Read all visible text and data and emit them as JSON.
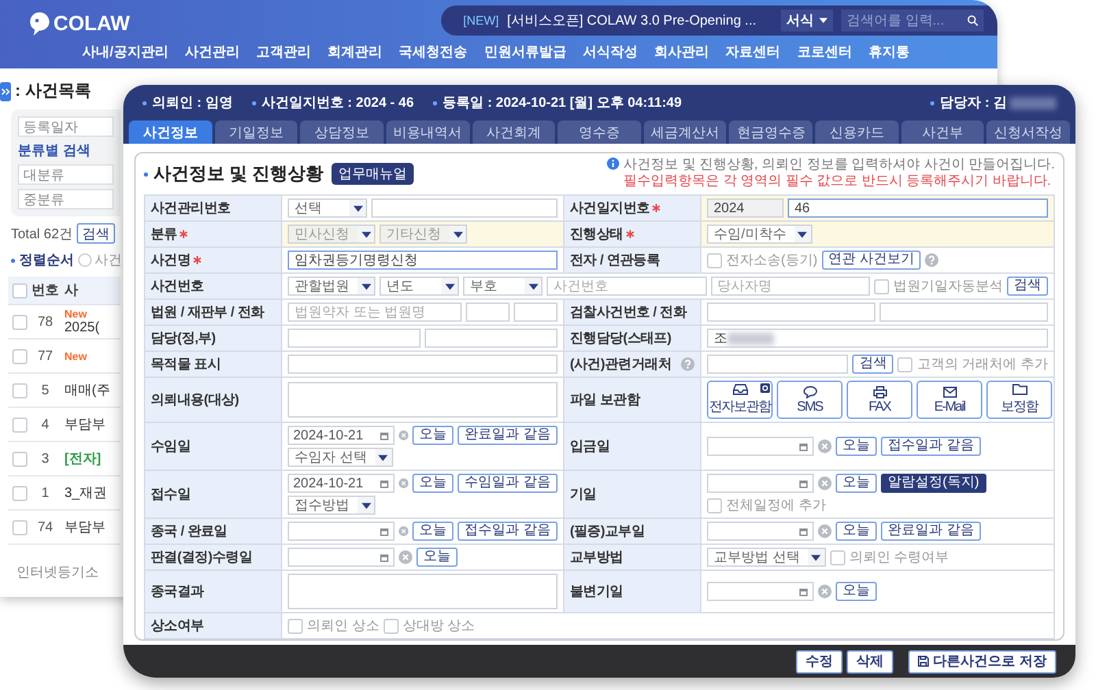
{
  "background_window": {
    "logo": "COLAW",
    "notice_tag": "[NEW]",
    "notice": "[서비스오픈] COLAW 3.0 Pre-Opening ...",
    "search_scope": "서식",
    "search_placeholder": "검색어를 입력...",
    "nav": [
      "사내/공지관리",
      "사건관리",
      "고객관리",
      "회계관리",
      "국세청전송",
      "민원서류발급",
      "서식작성",
      "회사관리",
      "자료센터",
      "코로센터",
      "휴지통"
    ],
    "list_title": ": 사건목록",
    "date_select": "등록일자",
    "category_label": "분류별 검색",
    "category_fields": [
      {
        "placeholder": "대분류"
      },
      {
        "placeholder": "중분류"
      }
    ],
    "total": "Total 62건",
    "search_button": "검색",
    "sort_label": "정렬순서",
    "sort_options": [
      {
        "label": "사건",
        "selected": false
      }
    ],
    "table": {
      "select_all_checked": false,
      "columns": [
        "번호",
        "사"
      ],
      "rows": [
        {
          "checked": false,
          "number": "78",
          "badge": "New",
          "title": "2025("
        },
        {
          "checked": false,
          "number": "77",
          "badge": "New"
        },
        {
          "checked": false,
          "number": "5",
          "title": "매매(주"
        },
        {
          "checked": false,
          "number": "4",
          "title": "부담부"
        },
        {
          "checked": false,
          "number": "3",
          "tag": "[전자]"
        },
        {
          "checked": false,
          "number": "1",
          "title": "3_재권"
        },
        {
          "checked": false,
          "number": "74",
          "title": "부담부"
        }
      ]
    },
    "footer_link": "인터넷등기소"
  },
  "case_window": {
    "summary": [
      "의뢰인 : 임영",
      "사건일지번호 : 2024 - 46",
      "등록일 : 2024-10-21 [월] 오후 04:11:49"
    ],
    "manager": "담당자 : 김",
    "tabs": [
      {
        "label": "사건정보",
        "selected": true
      },
      {
        "label": "기일정보",
        "selected": false
      },
      {
        "label": "상담정보",
        "selected": false
      },
      {
        "label": "비용내역서",
        "selected": false
      },
      {
        "label": "사건회계",
        "selected": false
      },
      {
        "label": "영수증",
        "selected": false
      },
      {
        "label": "세금계산서",
        "selected": false
      },
      {
        "label": "현금영수증",
        "selected": false
      },
      {
        "label": "신용카드",
        "selected": false
      },
      {
        "label": "사건부",
        "selected": false
      },
      {
        "label": "신청서작성",
        "selected": false
      }
    ],
    "section_title": "사건정보 및 진행상황",
    "manual_button": "업무매뉴얼",
    "notice": "사건정보 및 진행상황, 의뢰인 정보를 입력하셔야 사건이 만들어집니다.",
    "notice_required": "필수입력항목은 각 영역의 필수 값으로 반드시 등록해주시기 바랍니다.",
    "form": [
      {
        "fields": [
          {
            "label": "사건관리번호",
            "required": false,
            "highlight": false,
            "help": false,
            "lines": [
              [
                {
                  "kind": "select",
                  "text": "선택",
                  "disabled": false
                },
                {
                  "kind": "input",
                  "focused": false,
                  "disabled": false
                }
              ]
            ]
          },
          {
            "label": "사건일지번호",
            "required": true,
            "highlight": true,
            "help": false,
            "lines": [
              [
                {
                  "kind": "input",
                  "value": "2024",
                  "focused": false,
                  "disabled": true
                },
                {
                  "kind": "input",
                  "value": "46",
                  "focused": true,
                  "disabled": false
                }
              ]
            ]
          }
        ]
      },
      {
        "fields": [
          {
            "label": "분류",
            "required": true,
            "highlight": true,
            "help": false,
            "lines": [
              [
                {
                  "kind": "select",
                  "text": "민사신청",
                  "disabled": true
                },
                {
                  "kind": "select",
                  "text": "기타신청",
                  "disabled": true
                }
              ]
            ]
          },
          {
            "label": "진행상태",
            "required": true,
            "highlight": true,
            "help": false,
            "lines": [
              [
                {
                  "kind": "select",
                  "text": "수임/미착수",
                  "disabled": false
                }
              ]
            ]
          }
        ]
      },
      {
        "fields": [
          {
            "label": "사건명",
            "required": true,
            "highlight": false,
            "help": false,
            "lines": [
              [
                {
                  "kind": "input",
                  "value": "임차권등기명령신청",
                  "focused": true,
                  "disabled": false
                }
              ]
            ]
          },
          {
            "label": "전자 / 연관등록",
            "required": false,
            "highlight": false,
            "help": false,
            "lines": [
              [
                {
                  "kind": "check",
                  "label": "전자소송(등기)",
                  "checked": false
                },
                {
                  "kind": "button",
                  "label": "연관 사건보기",
                  "primary": false
                },
                {
                  "kind": "help"
                }
              ]
            ]
          }
        ]
      },
      {
        "fields": [
          {
            "label": "사건번호",
            "required": false,
            "highlight": false,
            "help": false,
            "lines": [
              [
                {
                  "kind": "select",
                  "text": "관할법원",
                  "disabled": false
                },
                {
                  "kind": "select",
                  "text": "년도",
                  "disabled": false
                },
                {
                  "kind": "select",
                  "text": "부호",
                  "disabled": false
                },
                {
                  "kind": "input",
                  "placeholder": "사건번호",
                  "focused": false,
                  "disabled": false
                },
                {
                  "kind": "input",
                  "placeholder": "당사자명",
                  "focused": false,
                  "disabled": false
                },
                {
                  "kind": "check",
                  "label": "법원기일자동분석",
                  "checked": false
                },
                {
                  "kind": "button",
                  "label": "검색",
                  "primary": false
                }
              ]
            ]
          }
        ]
      },
      {
        "fields": [
          {
            "label": "법원 / 재판부 / 전화",
            "required": false,
            "highlight": false,
            "help": false,
            "lines": [
              [
                {
                  "kind": "input",
                  "placeholder": "법원약자 또는 법원명",
                  "focused": false,
                  "disabled": false
                },
                {
                  "kind": "input",
                  "focused": false,
                  "disabled": false
                },
                {
                  "kind": "input",
                  "focused": false,
                  "disabled": false
                }
              ]
            ]
          },
          {
            "label": "검찰사건번호 / 전화",
            "required": false,
            "highlight": false,
            "help": false,
            "lines": [
              [
                {
                  "kind": "input",
                  "focused": false,
                  "disabled": false
                },
                {
                  "kind": "input",
                  "focused": false,
                  "disabled": false
                }
              ]
            ]
          }
        ]
      },
      {
        "fields": [
          {
            "label": "담당(정,부)",
            "required": false,
            "highlight": false,
            "help": false,
            "lines": [
              [
                {
                  "kind": "input",
                  "focused": false,
                  "disabled": false
                },
                {
                  "kind": "input",
                  "focused": false,
                  "disabled": false
                }
              ]
            ]
          },
          {
            "label": "진행담당(스태프)",
            "required": false,
            "highlight": false,
            "help": false,
            "lines": [
              [
                {
                  "kind": "input",
                  "value": "조",
                  "redacted": true,
                  "focused": false,
                  "disabled": false
                }
              ]
            ]
          }
        ]
      },
      {
        "fields": [
          {
            "label": "목적물 표시",
            "required": false,
            "highlight": false,
            "help": false,
            "lines": [
              [
                {
                  "kind": "input",
                  "focused": false,
                  "disabled": false
                }
              ]
            ]
          },
          {
            "label": "(사건)관련거래처",
            "required": false,
            "highlight": false,
            "help": true,
            "lines": [
              [
                {
                  "kind": "input",
                  "focused": false,
                  "disabled": false
                },
                {
                  "kind": "button",
                  "label": "검색",
                  "primary": false
                },
                {
                  "kind": "check",
                  "label": "고객의 거래처에 추가",
                  "checked": false
                }
              ]
            ]
          }
        ]
      },
      {
        "fields": [
          {
            "label": "의뢰내용(대상)",
            "required": false,
            "highlight": false,
            "help": false,
            "lines": [
              [
                {
                  "kind": "textarea"
                }
              ]
            ]
          },
          {
            "label": "파일 보관함",
            "required": false,
            "highlight": false,
            "help": false,
            "lines": [
              [
                {
                  "kind": "file",
                  "label": "전자보관함",
                  "badge": true
                },
                {
                  "kind": "file",
                  "label": "SMS",
                  "badge": false
                },
                {
                  "kind": "file",
                  "label": "FAX",
                  "badge": false
                },
                {
                  "kind": "file",
                  "label": "E-Mail",
                  "badge": false
                },
                {
                  "kind": "file",
                  "label": "보정함",
                  "badge": false
                }
              ]
            ]
          }
        ]
      },
      {
        "fields": [
          {
            "label": "수임일",
            "required": false,
            "highlight": false,
            "help": false,
            "lines": [
              [
                {
                  "kind": "date",
                  "value": "2024-10-21"
                },
                {
                  "kind": "clear"
                },
                {
                  "kind": "button",
                  "label": "오늘",
                  "primary": false
                },
                {
                  "kind": "button",
                  "label": "완료일과 같음",
                  "primary": false
                }
              ],
              [
                {
                  "kind": "select",
                  "text": "수임자 선택",
                  "disabled": false
                }
              ]
            ]
          },
          {
            "label": "입금일",
            "required": false,
            "highlight": false,
            "help": false,
            "lines": [
              [
                {
                  "kind": "date"
                },
                {
                  "kind": "clear"
                },
                {
                  "kind": "button",
                  "label": "오늘",
                  "primary": false
                },
                {
                  "kind": "button",
                  "label": "접수일과 같음",
                  "primary": false
                }
              ]
            ]
          }
        ]
      },
      {
        "fields": [
          {
            "label": "접수일",
            "required": false,
            "highlight": false,
            "help": false,
            "lines": [
              [
                {
                  "kind": "date",
                  "value": "2024-10-21"
                },
                {
                  "kind": "clear"
                },
                {
                  "kind": "button",
                  "label": "오늘",
                  "primary": false
                },
                {
                  "kind": "button",
                  "label": "수임일과 같음",
                  "primary": false
                }
              ],
              [
                {
                  "kind": "select",
                  "text": "접수방법",
                  "disabled": false
                }
              ]
            ]
          },
          {
            "label": "기일",
            "required": false,
            "highlight": false,
            "help": false,
            "lines": [
              [
                {
                  "kind": "date"
                },
                {
                  "kind": "clear"
                },
                {
                  "kind": "button",
                  "label": "오늘",
                  "primary": false
                },
                {
                  "kind": "button",
                  "label": "알람설정(독지)",
                  "primary": true
                }
              ],
              [
                {
                  "kind": "check",
                  "label": "전체일정에 추가",
                  "checked": false
                }
              ]
            ]
          }
        ]
      },
      {
        "fields": [
          {
            "label": "종국 / 완료일",
            "required": false,
            "highlight": false,
            "help": false,
            "lines": [
              [
                {
                  "kind": "date"
                },
                {
                  "kind": "clear"
                },
                {
                  "kind": "button",
                  "label": "오늘",
                  "primary": false
                },
                {
                  "kind": "button",
                  "label": "접수일과 같음",
                  "primary": false
                }
              ]
            ]
          },
          {
            "label": "(필증)교부일",
            "required": false,
            "highlight": false,
            "help": false,
            "lines": [
              [
                {
                  "kind": "date"
                },
                {
                  "kind": "clear"
                },
                {
                  "kind": "button",
                  "label": "오늘",
                  "primary": false
                },
                {
                  "kind": "button",
                  "label": "완료일과 같음",
                  "primary": false
                }
              ]
            ]
          }
        ]
      },
      {
        "fields": [
          {
            "label": "판결(결정)수령일",
            "required": false,
            "highlight": false,
            "help": false,
            "lines": [
              [
                {
                  "kind": "date"
                },
                {
                  "kind": "clear"
                },
                {
                  "kind": "button",
                  "label": "오늘",
                  "primary": false
                }
              ]
            ]
          },
          {
            "label": "교부방법",
            "required": false,
            "highlight": false,
            "help": false,
            "lines": [
              [
                {
                  "kind": "select",
                  "text": "교부방법 선택",
                  "disabled": false
                },
                {
                  "kind": "check",
                  "label": "의뢰인 수령여부",
                  "checked": false
                }
              ]
            ]
          }
        ]
      },
      {
        "fields": [
          {
            "label": "종국결과",
            "required": false,
            "highlight": false,
            "help": false,
            "lines": [
              [
                {
                  "kind": "textarea"
                }
              ]
            ]
          },
          {
            "label": "불변기일",
            "required": false,
            "highlight": false,
            "help": false,
            "lines": [
              [
                {
                  "kind": "date"
                },
                {
                  "kind": "clear"
                },
                {
                  "kind": "button",
                  "label": "오늘",
                  "primary": false
                }
              ]
            ]
          }
        ]
      },
      {
        "fields": [
          {
            "label": "상소여부",
            "required": false,
            "highlight": false,
            "help": false,
            "lines": [
              [
                {
                  "kind": "check",
                  "label": "의뢰인 상소",
                  "checked": false
                },
                {
                  "kind": "check",
                  "label": "상대방 상소",
                  "checked": false
                }
              ]
            ]
          }
        ]
      }
    ],
    "actions": [
      {
        "kind": "plain",
        "label": "수정"
      },
      {
        "kind": "plain",
        "label": "삭제"
      },
      {
        "kind": "save",
        "label": "다른사건으로 저장"
      }
    ]
  }
}
